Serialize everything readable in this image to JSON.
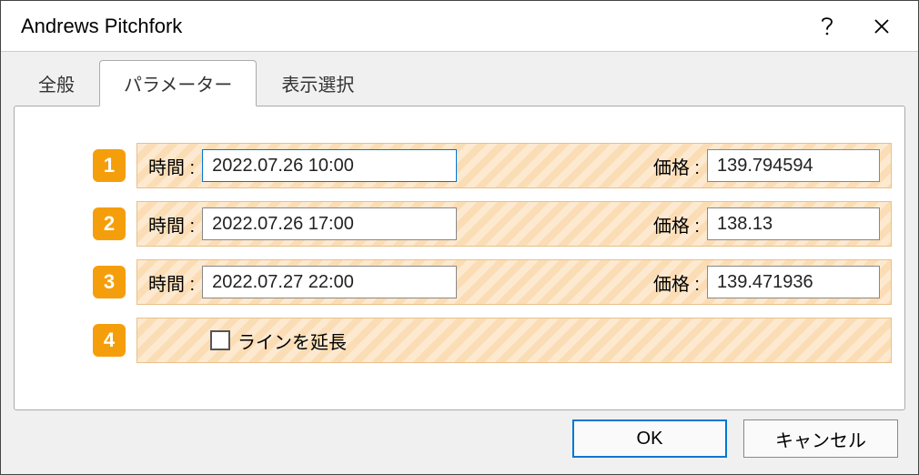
{
  "window": {
    "title": "Andrews Pitchfork"
  },
  "tabs": {
    "general": "全般",
    "parameters": "パラメーター",
    "visibility": "表示選択"
  },
  "labels": {
    "time": "時間 :",
    "price": "価格 :",
    "extend_lines": "ラインを延長"
  },
  "rows": [
    {
      "marker": "1",
      "time": "2022.07.26 10:00",
      "price": "139.794594"
    },
    {
      "marker": "2",
      "time": "2022.07.26 17:00",
      "price": "138.13"
    },
    {
      "marker": "3",
      "time": "2022.07.27 22:00",
      "price": "139.471936"
    }
  ],
  "row4_marker": "4",
  "buttons": {
    "ok": "OK",
    "cancel": "キャンセル"
  }
}
